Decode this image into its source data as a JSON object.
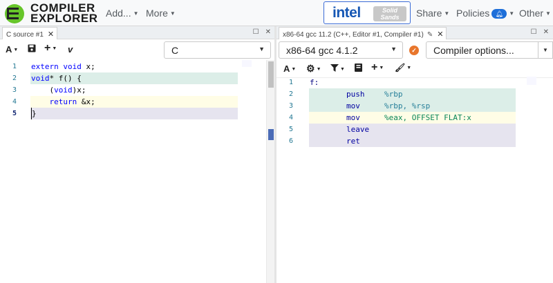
{
  "app": {
    "logo_line1": "COMPILER",
    "logo_line2": "EXPLORER",
    "nav_add": "Add...",
    "nav_more": "More",
    "sponsor_intel": "intel",
    "sponsor_solid_1": "Solid",
    "sponsor_solid_2": "Sands",
    "nav_share": "Share",
    "nav_policies": "Policies",
    "nav_other": "Other",
    "policies_badge_icon": "bell-icon",
    "accent": "#1e6fd9"
  },
  "left_pane": {
    "tab_title": "C source #1",
    "language": "C",
    "toolbar_icons": [
      "font-size-icon",
      "save-icon",
      "add-icon",
      "vim-icon"
    ],
    "lines": [
      {
        "n": "1",
        "text": "extern void x;"
      },
      {
        "n": "2",
        "text": "void* f() {"
      },
      {
        "n": "3",
        "text": "    (void)x;"
      },
      {
        "n": "4",
        "text": "    return &x;"
      },
      {
        "n": "5",
        "text": "}"
      }
    ]
  },
  "right_pane": {
    "tab_title": "x86-64 gcc 11.2 (C++, Editor #1, Compiler #1)",
    "compiler": "x86-64 gcc 4.1.2",
    "options_placeholder": "Compiler options...",
    "toolbar_icons": [
      "font-size-icon",
      "settings-icon",
      "filter-icon",
      "book-icon",
      "add-icon",
      "brush-icon"
    ],
    "lines": [
      {
        "n": "1",
        "label": "f:",
        "op": "",
        "args": ""
      },
      {
        "n": "2",
        "label": "",
        "op": "push",
        "args": "%rbp"
      },
      {
        "n": "3",
        "label": "",
        "op": "mov",
        "args": "%rbp, %rsp"
      },
      {
        "n": "4",
        "label": "",
        "op": "mov",
        "args": "%eax, OFFSET FLAT:x"
      },
      {
        "n": "5",
        "label": "",
        "op": "leave",
        "args": ""
      },
      {
        "n": "6",
        "label": "",
        "op": "ret",
        "args": ""
      }
    ]
  }
}
